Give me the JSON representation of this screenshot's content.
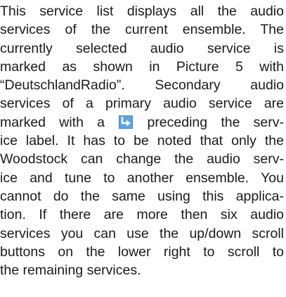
{
  "paragraph": {
    "lines": [
      "This service list displays all the audio",
      "services of the current ensemble. The",
      "currently selected audio service is",
      "marked as shown in Picture 5 with",
      "“DeutschlandRadio”. Secondary audio",
      "services of a primary audio service are",
      {
        "before": "marked with a",
        "icon": "secondary-service-arrow-icon",
        "after": "preceding the serv-"
      },
      "ice label. It has to be noted that only the",
      "Woodstock can change the audio serv-",
      "ice and tune to another ensemble. You",
      "cannot do the same using this applica-",
      "tion. If there are more then six audio",
      "services you can use the up/down scroll",
      "buttons on the lower right to scroll to",
      "the remaining services."
    ]
  }
}
